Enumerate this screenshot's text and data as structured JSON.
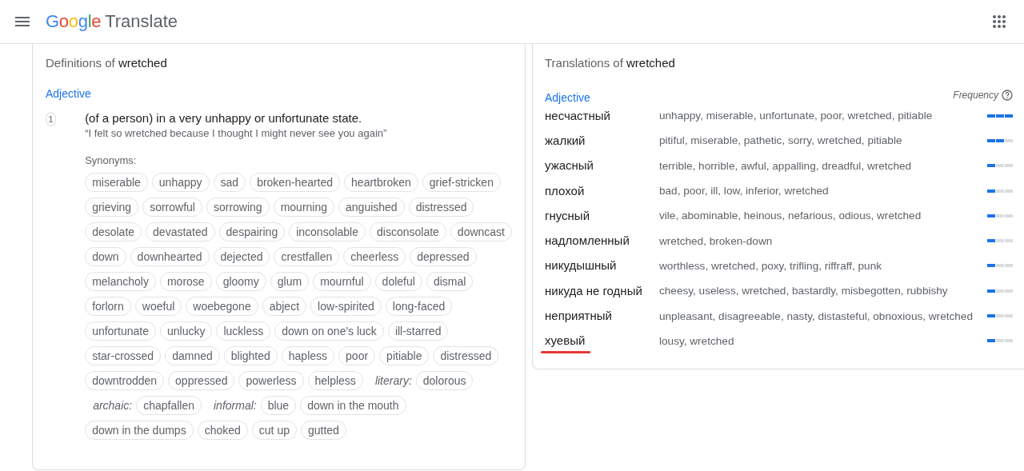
{
  "header": {
    "logo": "Google",
    "product": "Translate"
  },
  "definitions": {
    "title": "Definitions of",
    "word": "wretched",
    "part_of_speech": "Adjective",
    "entries": [
      {
        "number": "1",
        "definition": "(of a person) in a very unhappy or unfortunate state.",
        "example": "“I felt so wretched because I thought I might never see you again”",
        "synonyms_label": "Synonyms:",
        "synonym_rows": [
          [
            {
              "kind": "chip",
              "text": "miserable"
            },
            {
              "kind": "chip",
              "text": "unhappy"
            },
            {
              "kind": "chip",
              "text": "sad"
            },
            {
              "kind": "chip",
              "text": "broken-hearted"
            },
            {
              "kind": "chip",
              "text": "heartbroken"
            },
            {
              "kind": "chip",
              "text": "grief-stricken"
            }
          ],
          [
            {
              "kind": "chip",
              "text": "grieving"
            },
            {
              "kind": "chip",
              "text": "sorrowful"
            },
            {
              "kind": "chip",
              "text": "sorrowing"
            },
            {
              "kind": "chip",
              "text": "mourning"
            },
            {
              "kind": "chip",
              "text": "anguished"
            },
            {
              "kind": "chip",
              "text": "distressed"
            }
          ],
          [
            {
              "kind": "chip",
              "text": "desolate"
            },
            {
              "kind": "chip",
              "text": "devastated"
            },
            {
              "kind": "chip",
              "text": "despairing"
            },
            {
              "kind": "chip",
              "text": "inconsolable"
            },
            {
              "kind": "chip",
              "text": "disconsolate"
            },
            {
              "kind": "chip",
              "text": "downcast"
            }
          ],
          [
            {
              "kind": "chip",
              "text": "down"
            },
            {
              "kind": "chip",
              "text": "downhearted"
            },
            {
              "kind": "chip",
              "text": "dejected"
            },
            {
              "kind": "chip",
              "text": "crestfallen"
            },
            {
              "kind": "chip",
              "text": "cheerless"
            },
            {
              "kind": "chip",
              "text": "depressed"
            }
          ],
          [
            {
              "kind": "chip",
              "text": "melancholy"
            },
            {
              "kind": "chip",
              "text": "morose"
            },
            {
              "kind": "chip",
              "text": "gloomy"
            },
            {
              "kind": "chip",
              "text": "glum"
            },
            {
              "kind": "chip",
              "text": "mournful"
            },
            {
              "kind": "chip",
              "text": "doleful"
            },
            {
              "kind": "chip",
              "text": "dismal"
            }
          ],
          [
            {
              "kind": "chip",
              "text": "forlorn"
            },
            {
              "kind": "chip",
              "text": "woeful"
            },
            {
              "kind": "chip",
              "text": "woebegone"
            },
            {
              "kind": "chip",
              "text": "abject"
            },
            {
              "kind": "chip",
              "text": "low-spirited"
            },
            {
              "kind": "chip",
              "text": "long-faced"
            }
          ],
          [
            {
              "kind": "chip",
              "text": "unfortunate"
            },
            {
              "kind": "chip",
              "text": "unlucky"
            },
            {
              "kind": "chip",
              "text": "luckless"
            },
            {
              "kind": "chip",
              "text": "down on one's luck"
            },
            {
              "kind": "chip",
              "text": "ill-starred"
            }
          ],
          [
            {
              "kind": "chip",
              "text": "star-crossed"
            },
            {
              "kind": "chip",
              "text": "damned"
            },
            {
              "kind": "chip",
              "text": "blighted"
            },
            {
              "kind": "chip",
              "text": "hapless"
            },
            {
              "kind": "chip",
              "text": "poor"
            },
            {
              "kind": "chip",
              "text": "pitiable"
            },
            {
              "kind": "chip",
              "text": "distressed"
            }
          ],
          [
            {
              "kind": "chip",
              "text": "downtrodden"
            },
            {
              "kind": "chip",
              "text": "oppressed"
            },
            {
              "kind": "chip",
              "text": "powerless"
            },
            {
              "kind": "chip",
              "text": "helpless"
            },
            {
              "kind": "register",
              "text": "literary:"
            },
            {
              "kind": "chip",
              "text": "dolorous"
            }
          ],
          [
            {
              "kind": "register",
              "text": "archaic:"
            },
            {
              "kind": "chip",
              "text": "chapfallen"
            },
            {
              "kind": "register",
              "text": "informal:"
            },
            {
              "kind": "chip",
              "text": "blue"
            },
            {
              "kind": "chip",
              "text": "down in the mouth"
            }
          ],
          [
            {
              "kind": "chip",
              "text": "down in the dumps"
            },
            {
              "kind": "chip",
              "text": "choked"
            },
            {
              "kind": "chip",
              "text": "cut up"
            },
            {
              "kind": "chip",
              "text": "gutted"
            }
          ]
        ]
      }
    ]
  },
  "translations": {
    "title": "Translations of",
    "word": "wretched",
    "part_of_speech": "Adjective",
    "frequency_label": "Frequency",
    "rows": [
      {
        "word": "несчастный",
        "meanings": "unhappy, miserable, unfortunate, poor, wretched, pitiable",
        "level": 1,
        "underlined": false
      },
      {
        "word": "жалкий",
        "meanings": "pitiful, miserable, pathetic, sorry, wretched, pitiable",
        "level": 0.67,
        "underlined": false
      },
      {
        "word": "ужасный",
        "meanings": "terrible, horrible, awful, appalling, dreadful, wretched",
        "level": 0.33,
        "underlined": false
      },
      {
        "word": "плохой",
        "meanings": "bad, poor, ill, low, inferior, wretched",
        "level": 0.33,
        "underlined": false
      },
      {
        "word": "гнусный",
        "meanings": "vile, abominable, heinous, nefarious, odious, wretched",
        "level": 0.33,
        "underlined": false
      },
      {
        "word": "надломленный",
        "meanings": "wretched, broken-down",
        "level": 0.33,
        "underlined": false
      },
      {
        "word": "никудышный",
        "meanings": "worthless, wretched, poxy, trifling, riffraff, punk",
        "level": 0.33,
        "underlined": false
      },
      {
        "word": "никуда не годный",
        "meanings": "cheesy, useless, wretched, bastardly, misbegotten, rubbishy",
        "level": 0.33,
        "underlined": false
      },
      {
        "word": "неприятный",
        "meanings": "unpleasant, disagreeable, nasty, distasteful, obnoxious, wretched",
        "level": 0.33,
        "underlined": false
      },
      {
        "word": "хуевый",
        "meanings": "lousy, wretched",
        "level": 0.33,
        "underlined": true
      }
    ]
  }
}
